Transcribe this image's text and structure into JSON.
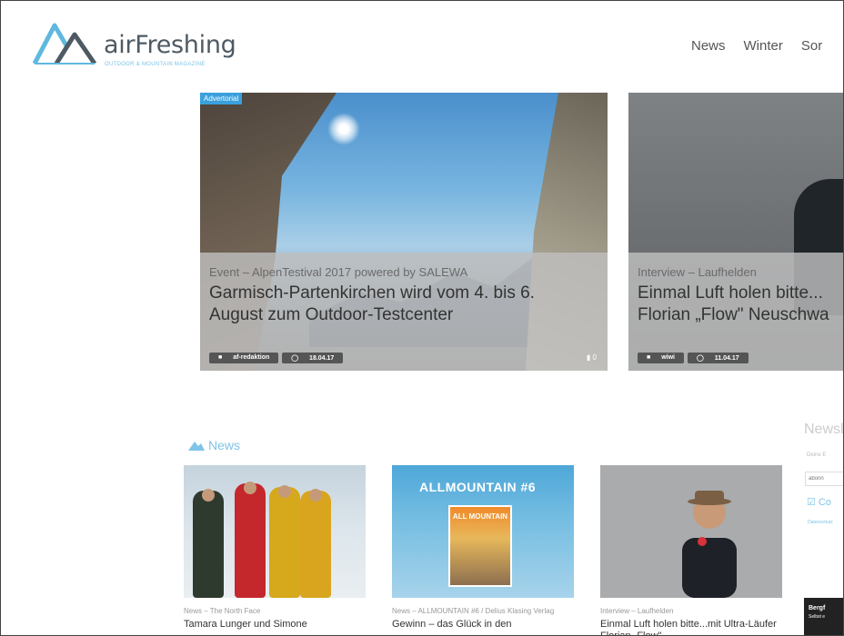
{
  "header": {
    "logo_text": "airFreshing",
    "tagline": "OUTDOOR & MOUNTAIN MAGAZINE",
    "nav": [
      "News",
      "Winter",
      "Sor"
    ]
  },
  "slider": [
    {
      "badge": "Advertorial",
      "category": "Event – AlpenTestival 2017 powered by SALEWA",
      "title_line1": "Garmisch-Partenkirchen wird vom 4. bis 6.",
      "title_line2": "August zum Outdoor-Testcenter",
      "author": "af-redaktion",
      "date": "18.04.17",
      "comments": "0"
    },
    {
      "category": "Interview – Laufhelden",
      "title_line1": "Einmal Luft holen bitte...",
      "title_line2": "Florian „Flow\" Neuschwa",
      "author": "wiwi",
      "date": "11.04.17"
    }
  ],
  "news": {
    "section_title": "News",
    "cards": [
      {
        "category": "News – The North Face",
        "title": "Tamara Lunger und Simone"
      },
      {
        "image_text": "ALLMOUNTAIN #6",
        "cover_text": "ALL MOUNTAIN",
        "category": "News – ALLMOUNTAIN #6 / Delius Klasing Verlag",
        "title": "Gewinn – das Glück in den"
      },
      {
        "category": "Interview – Laufhelden",
        "title": "Einmal Luft holen bitte...mit Ultra-Läufer Florian „Flow\""
      }
    ]
  },
  "sidebar": {
    "newsletter_title": "Newsl",
    "small_text": "Deine E",
    "input_placeholder": "abonn",
    "check_text": "Co",
    "link_text": "Datenschutz",
    "dark_box_text": "Bergf",
    "dark_box_sub": "Selbst e"
  },
  "colors": {
    "accent": "#7fc4e8",
    "badge": "#3aa0dc",
    "logo_text": "#4e5a63"
  }
}
